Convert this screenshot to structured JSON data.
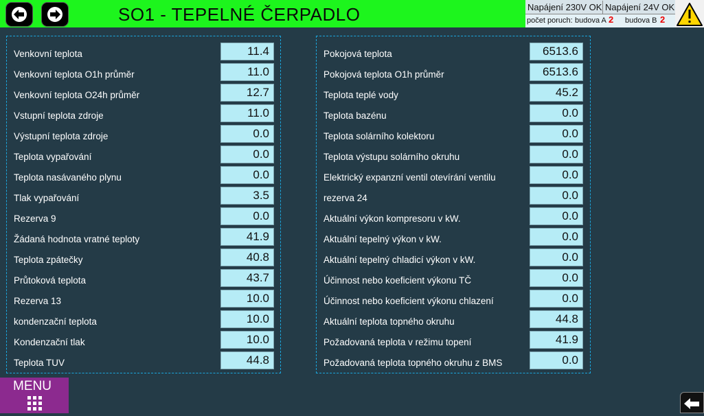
{
  "header": {
    "title": "SO1 - TEPELNÉ ČERPADLO"
  },
  "status": {
    "power_230": "Napájení 230V OK",
    "power_24": "Napájení 24V OK",
    "faults_label": "počet poruch:",
    "building_a_label": "budova A",
    "building_a_count": "2",
    "building_b_label": "budova B",
    "building_b_count": "2"
  },
  "icons": {
    "back": "arrow-left-icon",
    "forward": "arrow-right-icon",
    "warning": "warning-triangle-icon",
    "menu": "grid-icon",
    "return": "return-arrow-icon"
  },
  "colors": {
    "topbar": "#1df51d",
    "background": "#243b47",
    "value_box": "#b6ecf6",
    "menu": "#8c2a8f",
    "fault_count": "#e00000"
  },
  "left_panel": [
    {
      "label": "Venkovní teplota",
      "value": "11.4"
    },
    {
      "label": "Venkovní teplota O1h průměr",
      "value": "11.0"
    },
    {
      "label": "Venkovní teplota O24h průměr",
      "value": "12.7"
    },
    {
      "label": "Vstupní teplota zdroje",
      "value": "11.0"
    },
    {
      "label": "Výstupní teplota zdroje",
      "value": "0.0"
    },
    {
      "label": "Teplota vypařování",
      "value": "0.0"
    },
    {
      "label": "Teplota nasávaného plynu",
      "value": "0.0"
    },
    {
      "label": "Tlak vypařování",
      "value": "3.5"
    },
    {
      "label": "Rezerva 9",
      "value": "0.0"
    },
    {
      "label": "Žádaná hodnota vratné teploty",
      "value": "41.9"
    },
    {
      "label": "Teplota zpátečky",
      "value": "40.8"
    },
    {
      "label": "Průtoková teplota",
      "value": "43.7"
    },
    {
      "label": "Rezerva 13",
      "value": "10.0"
    },
    {
      "label": "kondenzační teplota",
      "value": "10.0"
    },
    {
      "label": "Kondenzační tlak",
      "value": "10.0"
    },
    {
      "label": "Teplota TUV",
      "value": "44.8"
    }
  ],
  "right_panel": [
    {
      "label": "Pokojová teplota",
      "value": "6513.6"
    },
    {
      "label": "Pokojová teplota O1h průměr",
      "value": "6513.6"
    },
    {
      "label": "Teplota teplé vody",
      "value": "45.2"
    },
    {
      "label": "Teplota bazénu",
      "value": "0.0"
    },
    {
      "label": "Teplota solárního kolektoru",
      "value": "0.0"
    },
    {
      "label": "Teplota výstupu solárního okruhu",
      "value": "0.0"
    },
    {
      "label": "Elektrický expanzní ventil otevírání ventilu",
      "value": "0.0"
    },
    {
      "label": "rezerva 24",
      "value": "0.0"
    },
    {
      "label": "Aktuální výkon kompresoru v kW.",
      "value": "0.0"
    },
    {
      "label": "Aktuální tepelný výkon v kW.",
      "value": "0.0"
    },
    {
      "label": "Aktuální tepelný chladicí výkon v kW.",
      "value": "0.0"
    },
    {
      "label": "Účinnost nebo koeficient výkonu TČ",
      "value": "0.0"
    },
    {
      "label": "Účinnost nebo koeficient výkonu chlazení",
      "value": "0.0"
    },
    {
      "label": "Aktuální teplota topného okruhu",
      "value": "44.8"
    },
    {
      "label": "Požadovaná teplota v režimu topení",
      "value": "41.9"
    },
    {
      "label": "Požadovaná teplota topného okruhu z BMS",
      "value": "0.0"
    }
  ],
  "menu": {
    "label": "MENU"
  }
}
